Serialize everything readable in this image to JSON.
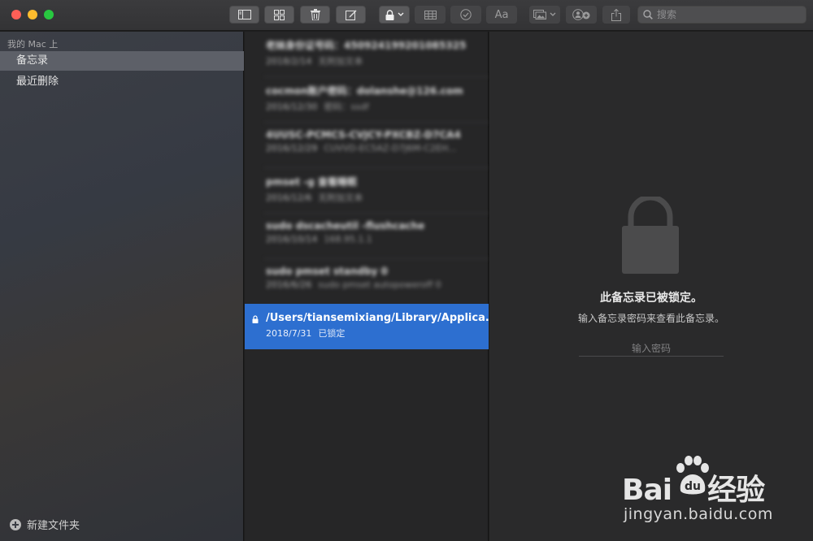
{
  "window": {
    "title": ""
  },
  "toolbar": {
    "search_placeholder": "搜索",
    "icons": [
      "sidebar-toggle-icon",
      "gallery-grid-icon",
      "trash-icon",
      "compose-icon",
      "lock-icon",
      "table-icon",
      "checklist-icon",
      "format-text-icon",
      "media-icon",
      "add-person-icon",
      "share-icon",
      "search-icon"
    ],
    "format_label": "Aa"
  },
  "sidebar": {
    "heading": "我的 Mac 上",
    "items": [
      {
        "label": "备忘录",
        "selected": true
      },
      {
        "label": "最近删除",
        "selected": false
      }
    ],
    "new_folder_label": "新建文件夹"
  },
  "notes": [
    {
      "title": "老妹身份证号码：450924199201085325",
      "date": "2018/2/14",
      "preview": "无附加文本",
      "blurred": true
    },
    {
      "title": "cocmon账户密码：dolanshe@126.com",
      "date": "2016/12/30",
      "preview": "密码：ssdf",
      "blurred": true
    },
    {
      "title": "4UUSC-PCMCS-CVJCY-PXCBZ-D7CA4",
      "date": "2016/12/29",
      "preview": "CUVVD-EC5AZ-D7J6M-C2EH...",
      "blurred": true
    },
    {
      "title": "pmset -g 查看睡眠",
      "date": "2016/12/6",
      "preview": "无附加文本",
      "blurred": true
    },
    {
      "title": "sudo dscacheutil -flushcache",
      "date": "2016/10/14",
      "preview": "168.95.1.1",
      "blurred": true
    },
    {
      "title": "sudo pmset standby 0",
      "date": "2016/6/26",
      "preview": "sudo pmset autopoweroff 0",
      "blurred": true
    },
    {
      "title": "/Users/tiansemixiang/Library/Applica...",
      "date": "2018/7/31",
      "preview": "已锁定",
      "blurred": false,
      "selected": true,
      "locked": true
    }
  ],
  "detail": {
    "locked_title": "此备忘录已被锁定。",
    "locked_subtitle": "输入备忘录密码来查看此备忘录。",
    "password_placeholder": "输入密码"
  },
  "watermark": {
    "logo": "Bai du 经验",
    "url": "jingyan.baidu.com"
  },
  "colors": {
    "selection": "#2d6fd0",
    "sidebar_selected": "#5d6068",
    "close": "#fe5f57",
    "minimize": "#febc2e",
    "maximize": "#28c840"
  }
}
